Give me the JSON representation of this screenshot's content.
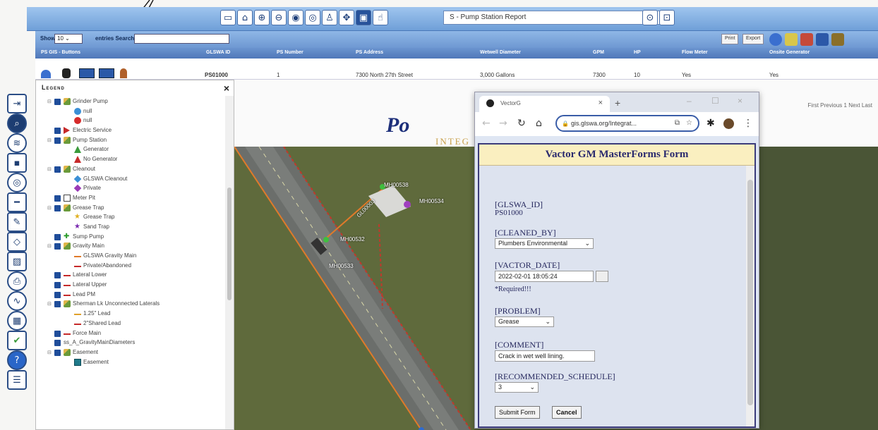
{
  "toolbar": {
    "buttons": [
      "monitor-icon",
      "home-icon",
      "zoom-in-icon",
      "zoom-out-icon",
      "zoom-extent-icon",
      "zoom-previous-icon",
      "person-icon",
      "pan-icon",
      "select-icon",
      "identify-icon"
    ],
    "layer_select_value": "S - Pump Station Report",
    "after_select": [
      "refresh-icon",
      "export-icon"
    ]
  },
  "table": {
    "show_label": "Show",
    "show_value": "10",
    "entries_label": "entries",
    "search_label": "Search:",
    "search_value": "",
    "print_label": "Print",
    "export_label": "Export",
    "columns": [
      "PS GIS - Buttons",
      "GLSWA ID",
      "PS Number",
      "PS Address",
      "Wetwell Diameter",
      "GPM",
      "HP",
      "Flow Meter",
      "Onsite Generator"
    ],
    "row": [
      "PS01000",
      "1",
      "7300 North 27th Street",
      "3,000 Gallons",
      "7300",
      "10",
      "Yes",
      "Yes"
    ]
  },
  "legend": {
    "title": "Legend",
    "close": "×",
    "items": [
      {
        "level": 1,
        "expander": "⊟",
        "checkbox": true,
        "symbol": "layers",
        "label": "Grinder Pump"
      },
      {
        "level": 2,
        "symbol": "circle-blue",
        "label": "null"
      },
      {
        "level": 2,
        "symbol": "circle-red",
        "label": "null"
      },
      {
        "level": 1,
        "checkbox": true,
        "symbol": "triangle-right-red",
        "label": "Electric Service"
      },
      {
        "level": 1,
        "expander": "⊟",
        "checkbox": true,
        "symbol": "layers",
        "label": "Pump Station"
      },
      {
        "level": 2,
        "symbol": "triangle-green",
        "label": "Generator"
      },
      {
        "level": 2,
        "symbol": "triangle-red",
        "label": "No Generator"
      },
      {
        "level": 1,
        "expander": "⊟",
        "checkbox": true,
        "symbol": "layers",
        "label": "Cleanout"
      },
      {
        "level": 2,
        "symbol": "diamond-blue",
        "label": "GLSWA Cleanout"
      },
      {
        "level": 2,
        "symbol": "diamond-purple",
        "label": "Private"
      },
      {
        "level": 1,
        "checkbox": true,
        "symbol": "square-outline",
        "label": "Meter Pit"
      },
      {
        "level": 1,
        "expander": "⊟",
        "checkbox": true,
        "symbol": "layers",
        "label": "Grease Trap"
      },
      {
        "level": 2,
        "symbol": "star-yellow",
        "label": "Grease Trap"
      },
      {
        "level": 2,
        "symbol": "star-purple",
        "label": "Sand Trap"
      },
      {
        "level": 1,
        "checkbox": true,
        "symbol": "cross-green",
        "label": "Sump Pump"
      },
      {
        "level": 1,
        "expander": "⊟",
        "checkbox": true,
        "symbol": "layers",
        "label": "Gravity Main"
      },
      {
        "level": 2,
        "symbol": "line-orange",
        "label": "GLSWA Gravity Main"
      },
      {
        "level": 2,
        "symbol": "line-red",
        "label": "Private/Abandoned"
      },
      {
        "level": 1,
        "checkbox": true,
        "symbol": "line-red",
        "label": "Lateral Lower"
      },
      {
        "level": 1,
        "checkbox": true,
        "symbol": "line-tick-red",
        "label": "Lateral Upper"
      },
      {
        "level": 1,
        "checkbox": true,
        "symbol": "line-tick-red",
        "label": "Lead PM"
      },
      {
        "level": 1,
        "expander": "⊟",
        "checkbox": true,
        "symbol": "layers",
        "label": "Sherman Lk Unconnected Laterals"
      },
      {
        "level": 2,
        "symbol": "line-tick-orange",
        "label": "1.25\" Lead"
      },
      {
        "level": 2,
        "symbol": "line-tick-red",
        "label": "2\"Shared Lead"
      },
      {
        "level": 1,
        "checkbox": true,
        "symbol": "line-red",
        "label": "Force Main"
      },
      {
        "level": 1,
        "checkbox": true,
        "symbol": "none",
        "label": "ss_A_GravityMainDiameters"
      },
      {
        "level": 1,
        "expander": "⊟",
        "checkbox": true,
        "symbol": "layers",
        "label": "Easement"
      },
      {
        "level": 2,
        "symbol": "square-teal",
        "label": "Easement"
      }
    ]
  },
  "map": {
    "labels": [
      "MH00538",
      "GL00003",
      "MH00532",
      "MH00533",
      "MH00534"
    ],
    "pager": "First  Previous  1  Next  Last",
    "logo": "Po",
    "logo_sub": "INTEG"
  },
  "browser": {
    "tab_title": "VectorG",
    "url": "gis.glswa.org/Integrat...",
    "form_title": "Vactor GM MasterForms Form",
    "fields": {
      "id_label": "[GLSWA_ID]",
      "id_value": "PS01000",
      "cleaned_label": "[CLEANED_BY]",
      "cleaned_value": "Plumbers Environmental",
      "date_label": "[VACTOR_DATE]",
      "date_value": "2022-02-01 18:05:24",
      "required_note": "*Required!!!",
      "problem_label": "[PROBLEM]",
      "problem_value": "Grease",
      "comment_label": "[COMMENT]",
      "comment_value": "Crack in wet well lining.",
      "schedule_label": "[RECOMMENDED_SCHEDULE]",
      "schedule_value": "3"
    },
    "submit_label": "Submit Form",
    "cancel_label": "Cancel"
  },
  "sidebar": [
    "login-icon",
    "search-icon",
    "layers-icon",
    "basemap-icon",
    "target-icon",
    "measure-icon",
    "draw-icon",
    "locate-icon",
    "photo-icon",
    "print-icon",
    "sewer-icon",
    "grid-icon",
    "check-icon",
    "help-icon",
    "list-icon"
  ]
}
